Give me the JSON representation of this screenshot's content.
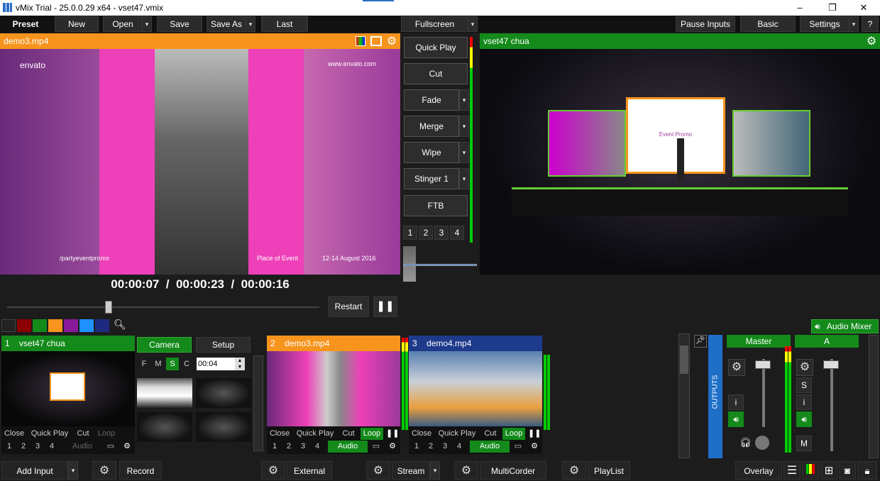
{
  "window": {
    "title": "vMix Trial - 25.0.0.29 x64 - vset47.vmix",
    "minimize": "–",
    "maximize": "❐",
    "close": "✕"
  },
  "toolbar": {
    "preset": "Preset",
    "new": "New",
    "open": "Open",
    "save": "Save",
    "save_as": "Save As",
    "last": "Last",
    "fullscreen": "Fullscreen",
    "pause_inputs": "Pause Inputs",
    "basic": "Basic",
    "settings": "Settings",
    "help": "?"
  },
  "preview": {
    "title": "demo3.mp4",
    "timecode": "00:00:07  /  00:00:23  /  00:00:16",
    "restart": "Restart",
    "pause": "❚❚",
    "frame_brand": "envato",
    "frame_url": "www.envato.com",
    "frame_social": "/partyeventpromo",
    "frame_place": "Place of Event",
    "frame_date": "12-14 August 2016"
  },
  "transitions": {
    "quick_play": "Quick Play",
    "cut": "Cut",
    "fade": "Fade",
    "merge": "Merge",
    "wipe": "Wipe",
    "stinger": "Stinger 1",
    "ftb": "FTB",
    "numbers": [
      "1",
      "2",
      "3",
      "4"
    ]
  },
  "output": {
    "title": "vset47 chua",
    "stage_text": "Event Promo"
  },
  "colors": {
    "accent_orange": "#f7941d",
    "accent_green": "#138a1a",
    "accent_blue": "#1e3a8a",
    "swatches": [
      "#222222",
      "#8b0000",
      "#138a1a",
      "#f7941d",
      "#8a1a9a",
      "#1e90ff",
      "#1e2a80"
    ]
  },
  "audio_mixer": {
    "label": "Audio Mixer",
    "outputs": "OUTPUTS",
    "master": "Master",
    "bus_a": "A",
    "s": "S",
    "i": "i",
    "m": "M"
  },
  "inputs": [
    {
      "num": "1",
      "title": "vset47 chua",
      "close": "Close",
      "quick_play": "Quick Play",
      "cut": "Cut",
      "loop": "Loop",
      "nums": [
        "1",
        "2",
        "3",
        "4"
      ],
      "audio": "Audio"
    },
    {
      "num": "2",
      "title": "demo3.mp4",
      "close": "Close",
      "quick_play": "Quick Play",
      "cut": "Cut",
      "loop": "Loop",
      "nums": [
        "1",
        "2",
        "3",
        "4"
      ],
      "audio": "Audio"
    },
    {
      "num": "3",
      "title": "demo4.mp4",
      "close": "Close",
      "quick_play": "Quick Play",
      "cut": "Cut",
      "loop": "Loop",
      "nums": [
        "1",
        "2",
        "3",
        "4"
      ],
      "audio": "Audio"
    }
  ],
  "camera": {
    "camera": "Camera",
    "setup": "Setup",
    "f": "F",
    "m": "M",
    "s": "S",
    "c": "C",
    "duration": "00:04"
  },
  "bottom": {
    "add_input": "Add Input",
    "record": "Record",
    "external": "External",
    "stream": "Stream",
    "multicorder": "MultiCorder",
    "playlist": "PlayList",
    "overlay": "Overlay"
  }
}
